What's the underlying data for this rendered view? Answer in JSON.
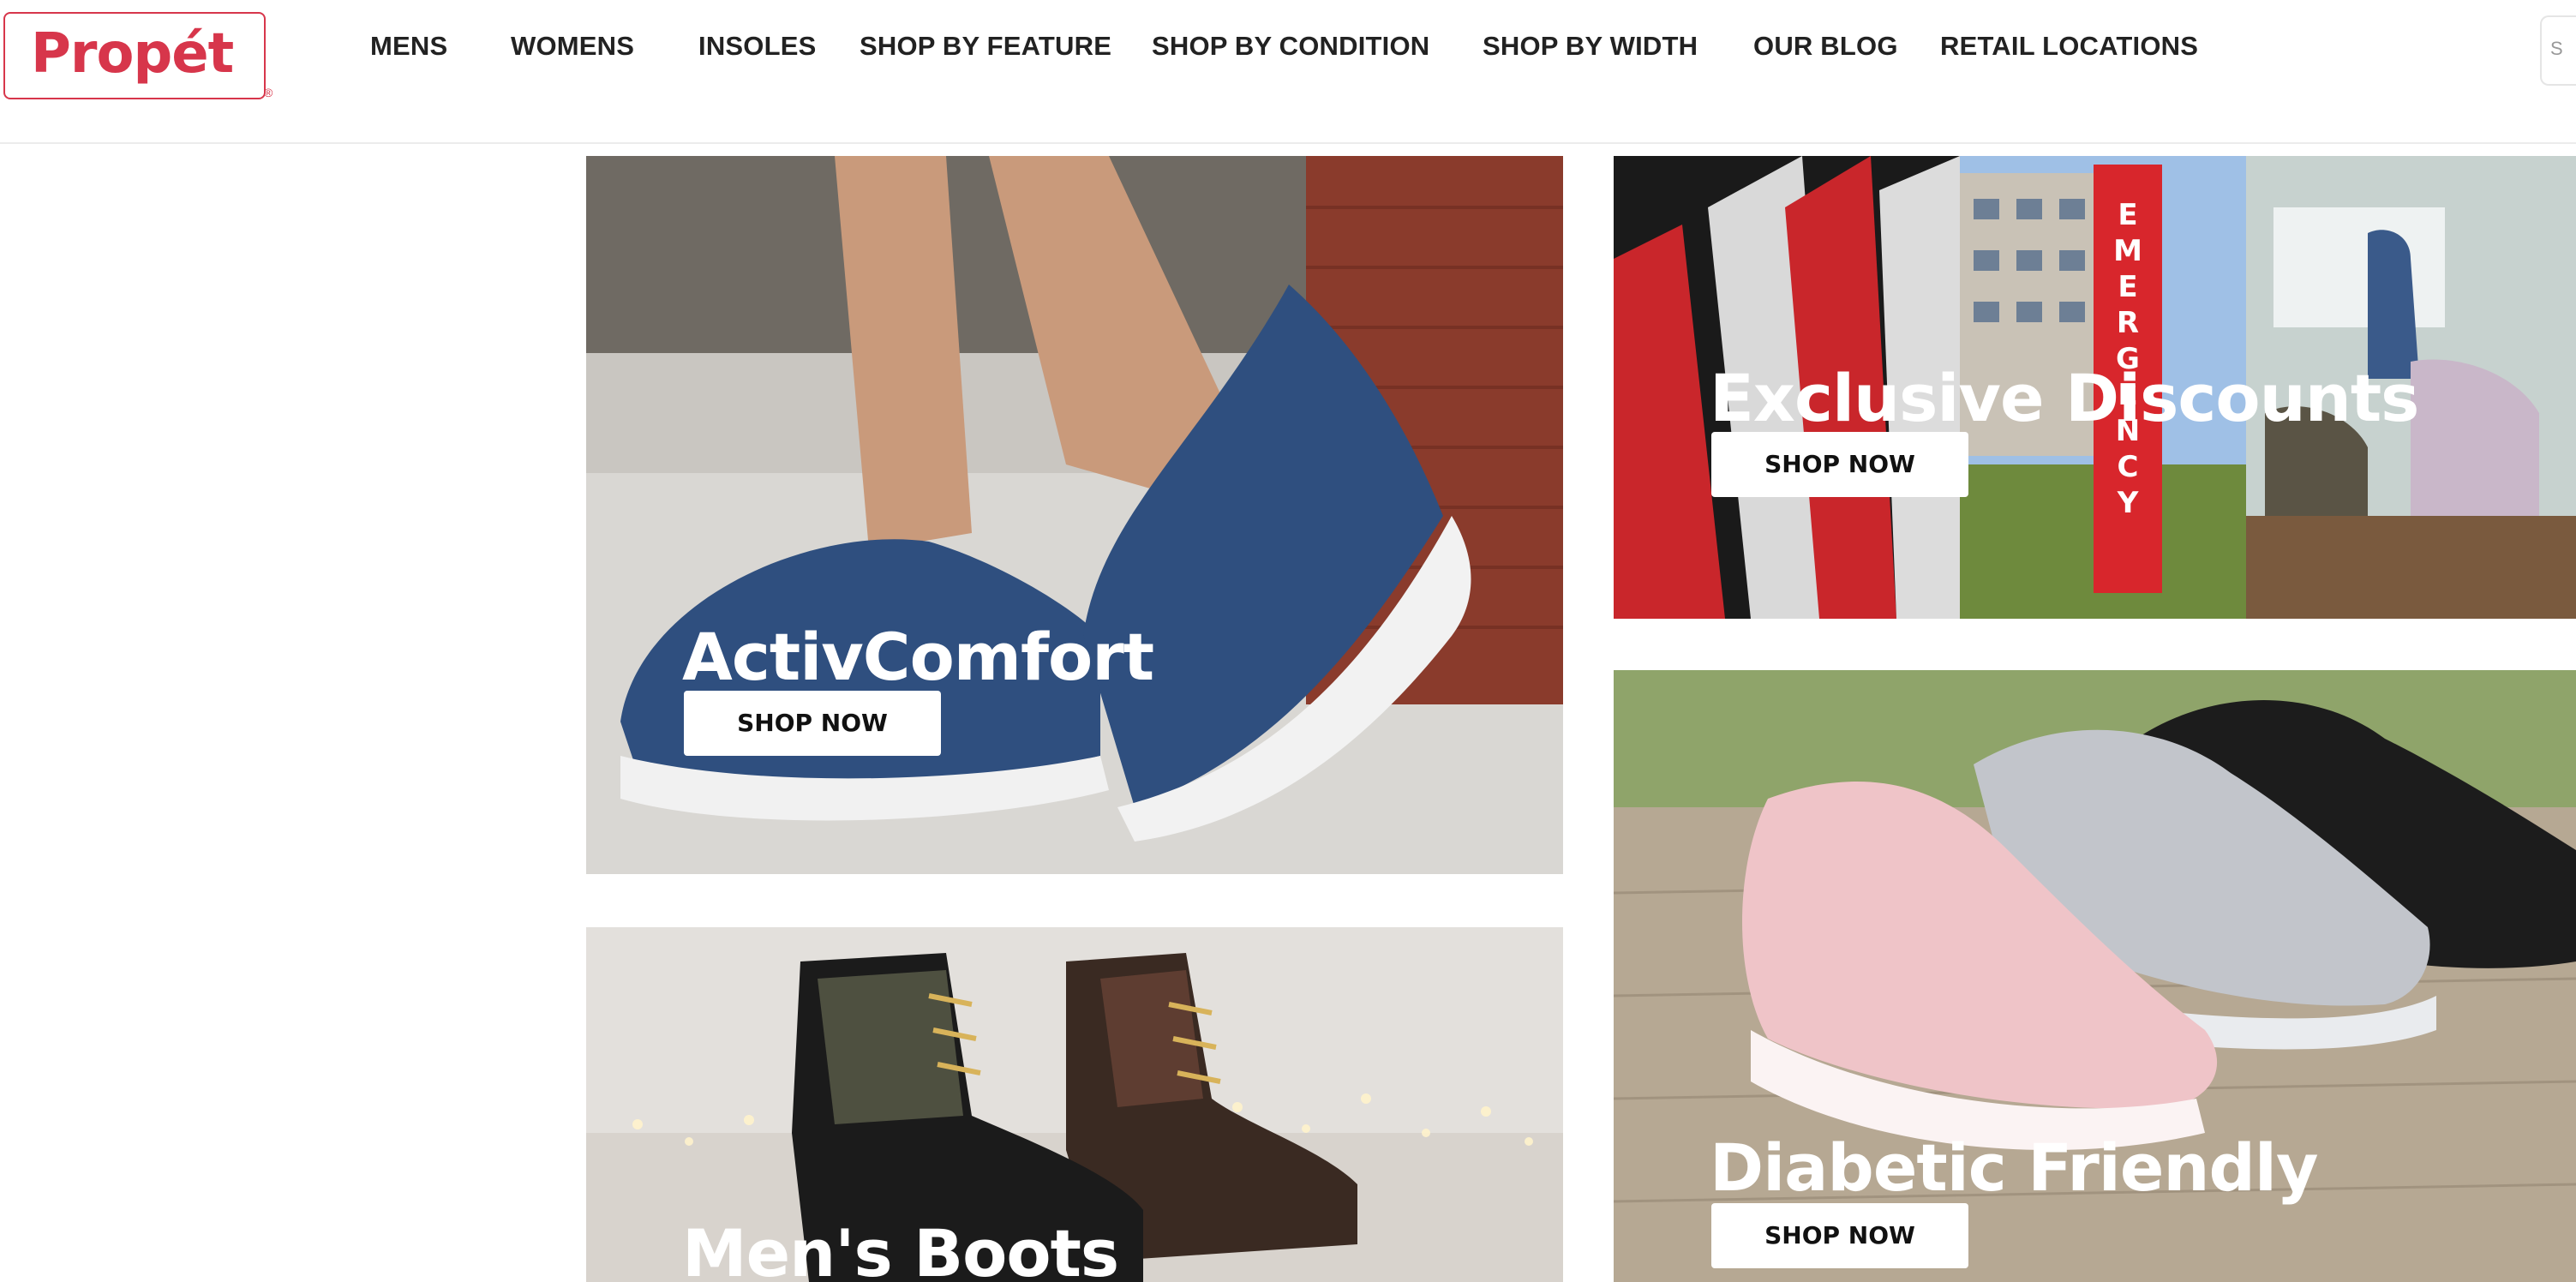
{
  "brand": {
    "logo_text": "Propét",
    "logo_mark": "®"
  },
  "nav": {
    "items": [
      {
        "label": "MENS"
      },
      {
        "label": "WOMENS"
      },
      {
        "label": "INSOLES"
      },
      {
        "label": "SHOP BY FEATURE"
      },
      {
        "label": "SHOP BY CONDITION"
      },
      {
        "label": "SHOP BY WIDTH"
      },
      {
        "label": "OUR BLOG"
      },
      {
        "label": "RETAIL LOCATIONS"
      }
    ]
  },
  "search": {
    "visible_glyph": "S"
  },
  "tiles": [
    {
      "title": "ActivComfort",
      "button": "SHOP NOW"
    },
    {
      "title": "Exclusive Discounts",
      "button": "SHOP NOW",
      "sign_text": "EMERGENCY"
    },
    {
      "title": "Diabetic Friendly",
      "button": "SHOP NOW"
    },
    {
      "title": "Men's Boots"
    }
  ],
  "colors": {
    "brand_red": "#d7364b",
    "nav_text": "#222222",
    "button_bg": "#ffffff"
  }
}
